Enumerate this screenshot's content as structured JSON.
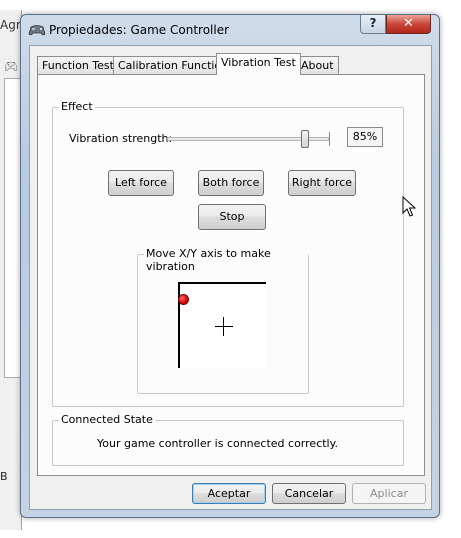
{
  "background_window": {
    "title_fragment": "Agr",
    "bottom_text": "B J"
  },
  "dialog": {
    "title": "Propiedades: Game Controller",
    "help_label": "?",
    "close_label": "✕"
  },
  "tabs": [
    {
      "label": "Function Test",
      "active": false
    },
    {
      "label": "Calibration Function",
      "active": false
    },
    {
      "label": "Vibration Test",
      "active": true
    },
    {
      "label": "About",
      "active": false
    }
  ],
  "effect": {
    "group_label": "Effect",
    "strength_label": "Vibration strength:",
    "strength_value": "85%",
    "strength_level": 0.85,
    "left_force": "Left force",
    "both_force": "Both force",
    "right_force": "Right force",
    "stop": "Stop",
    "xy_group_label": "Move X/Y axis to make vibration"
  },
  "connected_state": {
    "group_label": "Connected State",
    "message": "Your game controller is connected correctly."
  },
  "footer": {
    "ok": "Aceptar",
    "cancel": "Cancelar",
    "apply": "Aplicar"
  },
  "colors": {
    "indicator": "#d40000",
    "close_button": "#c9473a",
    "disabled_text": "#8a8a8a"
  }
}
